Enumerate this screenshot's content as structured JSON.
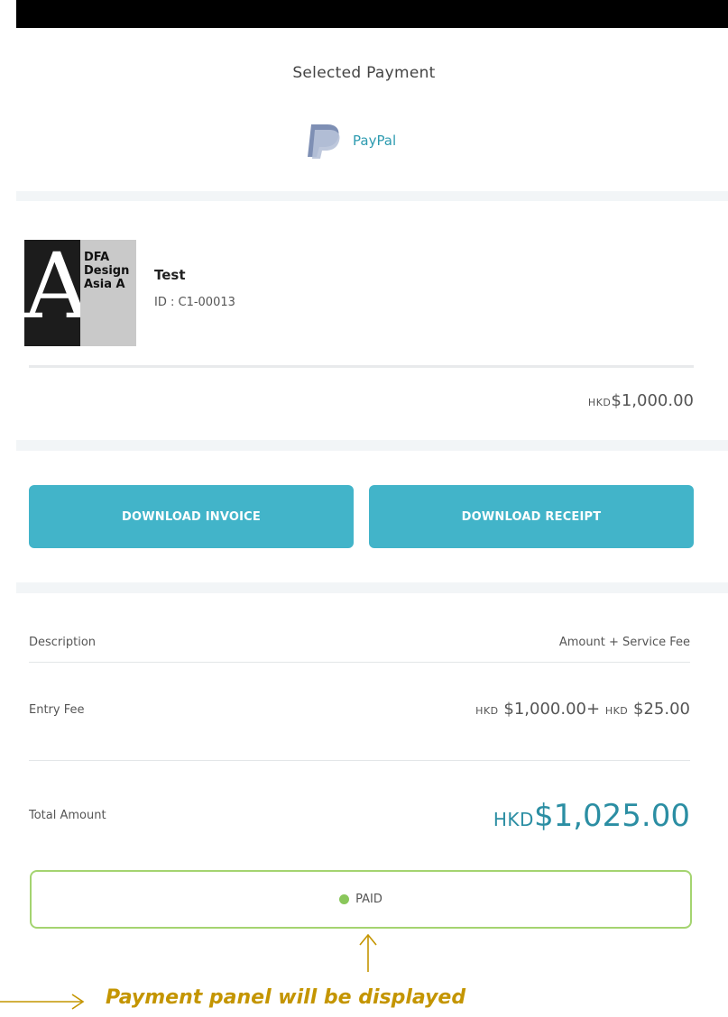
{
  "payment": {
    "title": "Selected Payment",
    "method_icon": "paypal-logo-icon",
    "method_name": "PayPal"
  },
  "entry": {
    "thumbnail_text": "DFA\nDesign\nAsia A",
    "title": "Test",
    "id_text": "ID : C1-00013",
    "price_currency": "HKD",
    "price_amount": "$1,000.00"
  },
  "actions": {
    "invoice_label": "DOWNLOAD INVOICE",
    "receipt_label": "DOWNLOAD RECEIPT",
    "button_color": "#42b4c9"
  },
  "summary": {
    "col_description": "Description",
    "col_amount": "Amount + Service Fee",
    "fee_label": "Entry Fee",
    "fee_currency": "HKD",
    "fee_amount": "$1,000.00+",
    "service_currency": "HKD",
    "service_amount": "$25.00",
    "total_label": "Total Amount",
    "total_currency": "HKD",
    "total_amount": "$1,025.00",
    "total_color": "#2b8ea3"
  },
  "status": {
    "label": "PAID",
    "color": "#8ac75b"
  },
  "annotation": {
    "text": "Payment panel will be displayed",
    "color": "#c49500"
  }
}
